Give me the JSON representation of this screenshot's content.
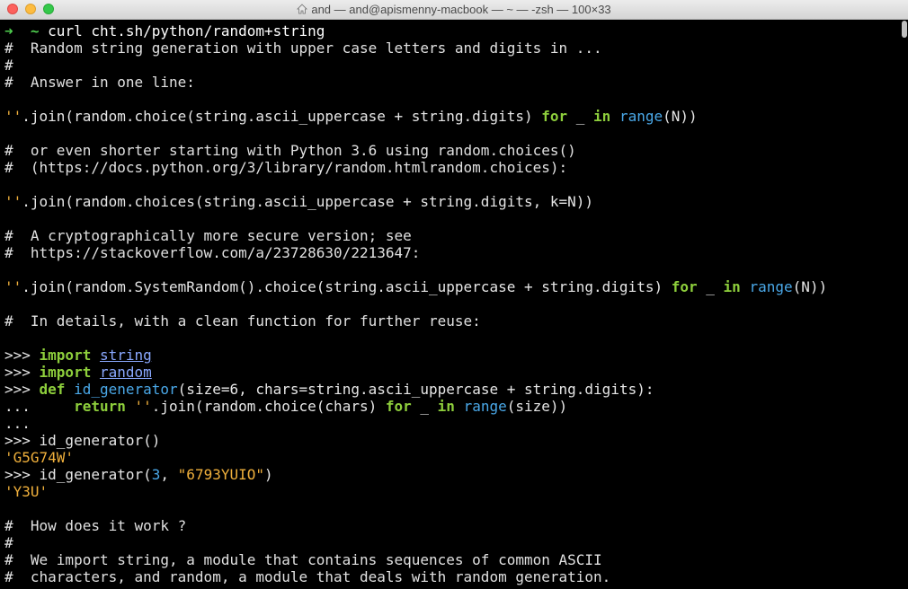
{
  "window": {
    "title": "and — and@apismenny-macbook — ~ — -zsh — 100×33"
  },
  "colors": {
    "string": "#f0b03c",
    "keyword": "#8ecf3c",
    "builtin": "#4aa8e8",
    "module": "#8aa8ff",
    "prompt_arrow": "#4fd04f"
  },
  "lines": [
    [
      {
        "t": "➜  ",
        "c": "c-prompt-arrow"
      },
      {
        "t": "~ ",
        "c": "c-prompt-arrow"
      },
      {
        "t": "curl cht.sh/python/random+string",
        "c": "c-cmd"
      }
    ],
    [
      {
        "t": "#  Random string generation with upper case letters and digits in ...",
        "c": "c-comment"
      }
    ],
    [
      {
        "t": "#",
        "c": "c-comment"
      }
    ],
    [
      {
        "t": "#  Answer in one line:",
        "c": "c-comment"
      }
    ],
    [],
    [
      {
        "t": "''",
        "c": "c-str"
      },
      {
        "t": ".join(random.choice(string.ascii_uppercase + string.digits) ",
        "c": "c-plain"
      },
      {
        "t": "for",
        "c": "c-kw"
      },
      {
        "t": " _ ",
        "c": "c-plain"
      },
      {
        "t": "in",
        "c": "c-kw"
      },
      {
        "t": " ",
        "c": "c-plain"
      },
      {
        "t": "range",
        "c": "c-builtin"
      },
      {
        "t": "(N))",
        "c": "c-plain"
      }
    ],
    [],
    [
      {
        "t": "#  or even shorter starting with Python 3.6 using random.choices()",
        "c": "c-comment"
      }
    ],
    [
      {
        "t": "#  (https://docs.python.org/3/library/random.htmlrandom.choices):",
        "c": "c-comment"
      }
    ],
    [],
    [
      {
        "t": "''",
        "c": "c-str"
      },
      {
        "t": ".join(random.choices(string.ascii_uppercase + string.digits, k=N))",
        "c": "c-plain"
      }
    ],
    [],
    [
      {
        "t": "#  A cryptographically more secure version; see",
        "c": "c-comment"
      }
    ],
    [
      {
        "t": "#  https://stackoverflow.com/a/23728630/2213647:",
        "c": "c-comment"
      }
    ],
    [],
    [
      {
        "t": "''",
        "c": "c-str"
      },
      {
        "t": ".join(random.SystemRandom().choice(string.ascii_uppercase + string.digits) ",
        "c": "c-plain"
      },
      {
        "t": "for",
        "c": "c-kw"
      },
      {
        "t": " _ ",
        "c": "c-plain"
      },
      {
        "t": "in",
        "c": "c-kw"
      },
      {
        "t": " ",
        "c": "c-plain"
      },
      {
        "t": "range",
        "c": "c-builtin"
      },
      {
        "t": "(N))",
        "c": "c-plain"
      }
    ],
    [],
    [
      {
        "t": "#  In details, with a clean function for further reuse:",
        "c": "c-comment"
      }
    ],
    [],
    [
      {
        "t": ">>> ",
        "c": "c-plain-b"
      },
      {
        "t": "import",
        "c": "c-kw"
      },
      {
        "t": " ",
        "c": "c-plain"
      },
      {
        "t": "string",
        "c": "c-mod"
      }
    ],
    [
      {
        "t": ">>> ",
        "c": "c-plain-b"
      },
      {
        "t": "import",
        "c": "c-kw"
      },
      {
        "t": " ",
        "c": "c-plain"
      },
      {
        "t": "random",
        "c": "c-mod"
      }
    ],
    [
      {
        "t": ">>> ",
        "c": "c-plain-b"
      },
      {
        "t": "def",
        "c": "c-kw"
      },
      {
        "t": " ",
        "c": "c-plain"
      },
      {
        "t": "id_generator",
        "c": "c-fn"
      },
      {
        "t": "(size=6, chars=string.ascii_uppercase + string.digits):",
        "c": "c-plain"
      }
    ],
    [
      {
        "t": "...     ",
        "c": "c-plain-b"
      },
      {
        "t": "return",
        "c": "c-kw"
      },
      {
        "t": " ",
        "c": "c-plain"
      },
      {
        "t": "''",
        "c": "c-str"
      },
      {
        "t": ".join(random.choice(chars) ",
        "c": "c-plain"
      },
      {
        "t": "for",
        "c": "c-kw"
      },
      {
        "t": " _ ",
        "c": "c-plain"
      },
      {
        "t": "in",
        "c": "c-kw"
      },
      {
        "t": " ",
        "c": "c-plain"
      },
      {
        "t": "range",
        "c": "c-builtin"
      },
      {
        "t": "(size))",
        "c": "c-plain"
      }
    ],
    [
      {
        "t": "...",
        "c": "c-plain-b"
      }
    ],
    [
      {
        "t": ">>> ",
        "c": "c-plain-b"
      },
      {
        "t": "id_generator()",
        "c": "c-plain"
      }
    ],
    [
      {
        "t": "'G5G74W'",
        "c": "c-str"
      }
    ],
    [
      {
        "t": ">>> ",
        "c": "c-plain-b"
      },
      {
        "t": "id_generator(",
        "c": "c-plain"
      },
      {
        "t": "3",
        "c": "c-num"
      },
      {
        "t": ", ",
        "c": "c-plain"
      },
      {
        "t": "\"6793YUIO\"",
        "c": "c-str"
      },
      {
        "t": ")",
        "c": "c-plain"
      }
    ],
    [
      {
        "t": "'Y3U'",
        "c": "c-str"
      }
    ],
    [],
    [
      {
        "t": "#  How does it work ?",
        "c": "c-comment"
      }
    ],
    [
      {
        "t": "#",
        "c": "c-comment"
      }
    ],
    [
      {
        "t": "#  We import string, a module that contains sequences of common ASCII",
        "c": "c-comment"
      }
    ],
    [
      {
        "t": "#  characters, and random, a module that deals with random generation.",
        "c": "c-comment"
      }
    ]
  ]
}
